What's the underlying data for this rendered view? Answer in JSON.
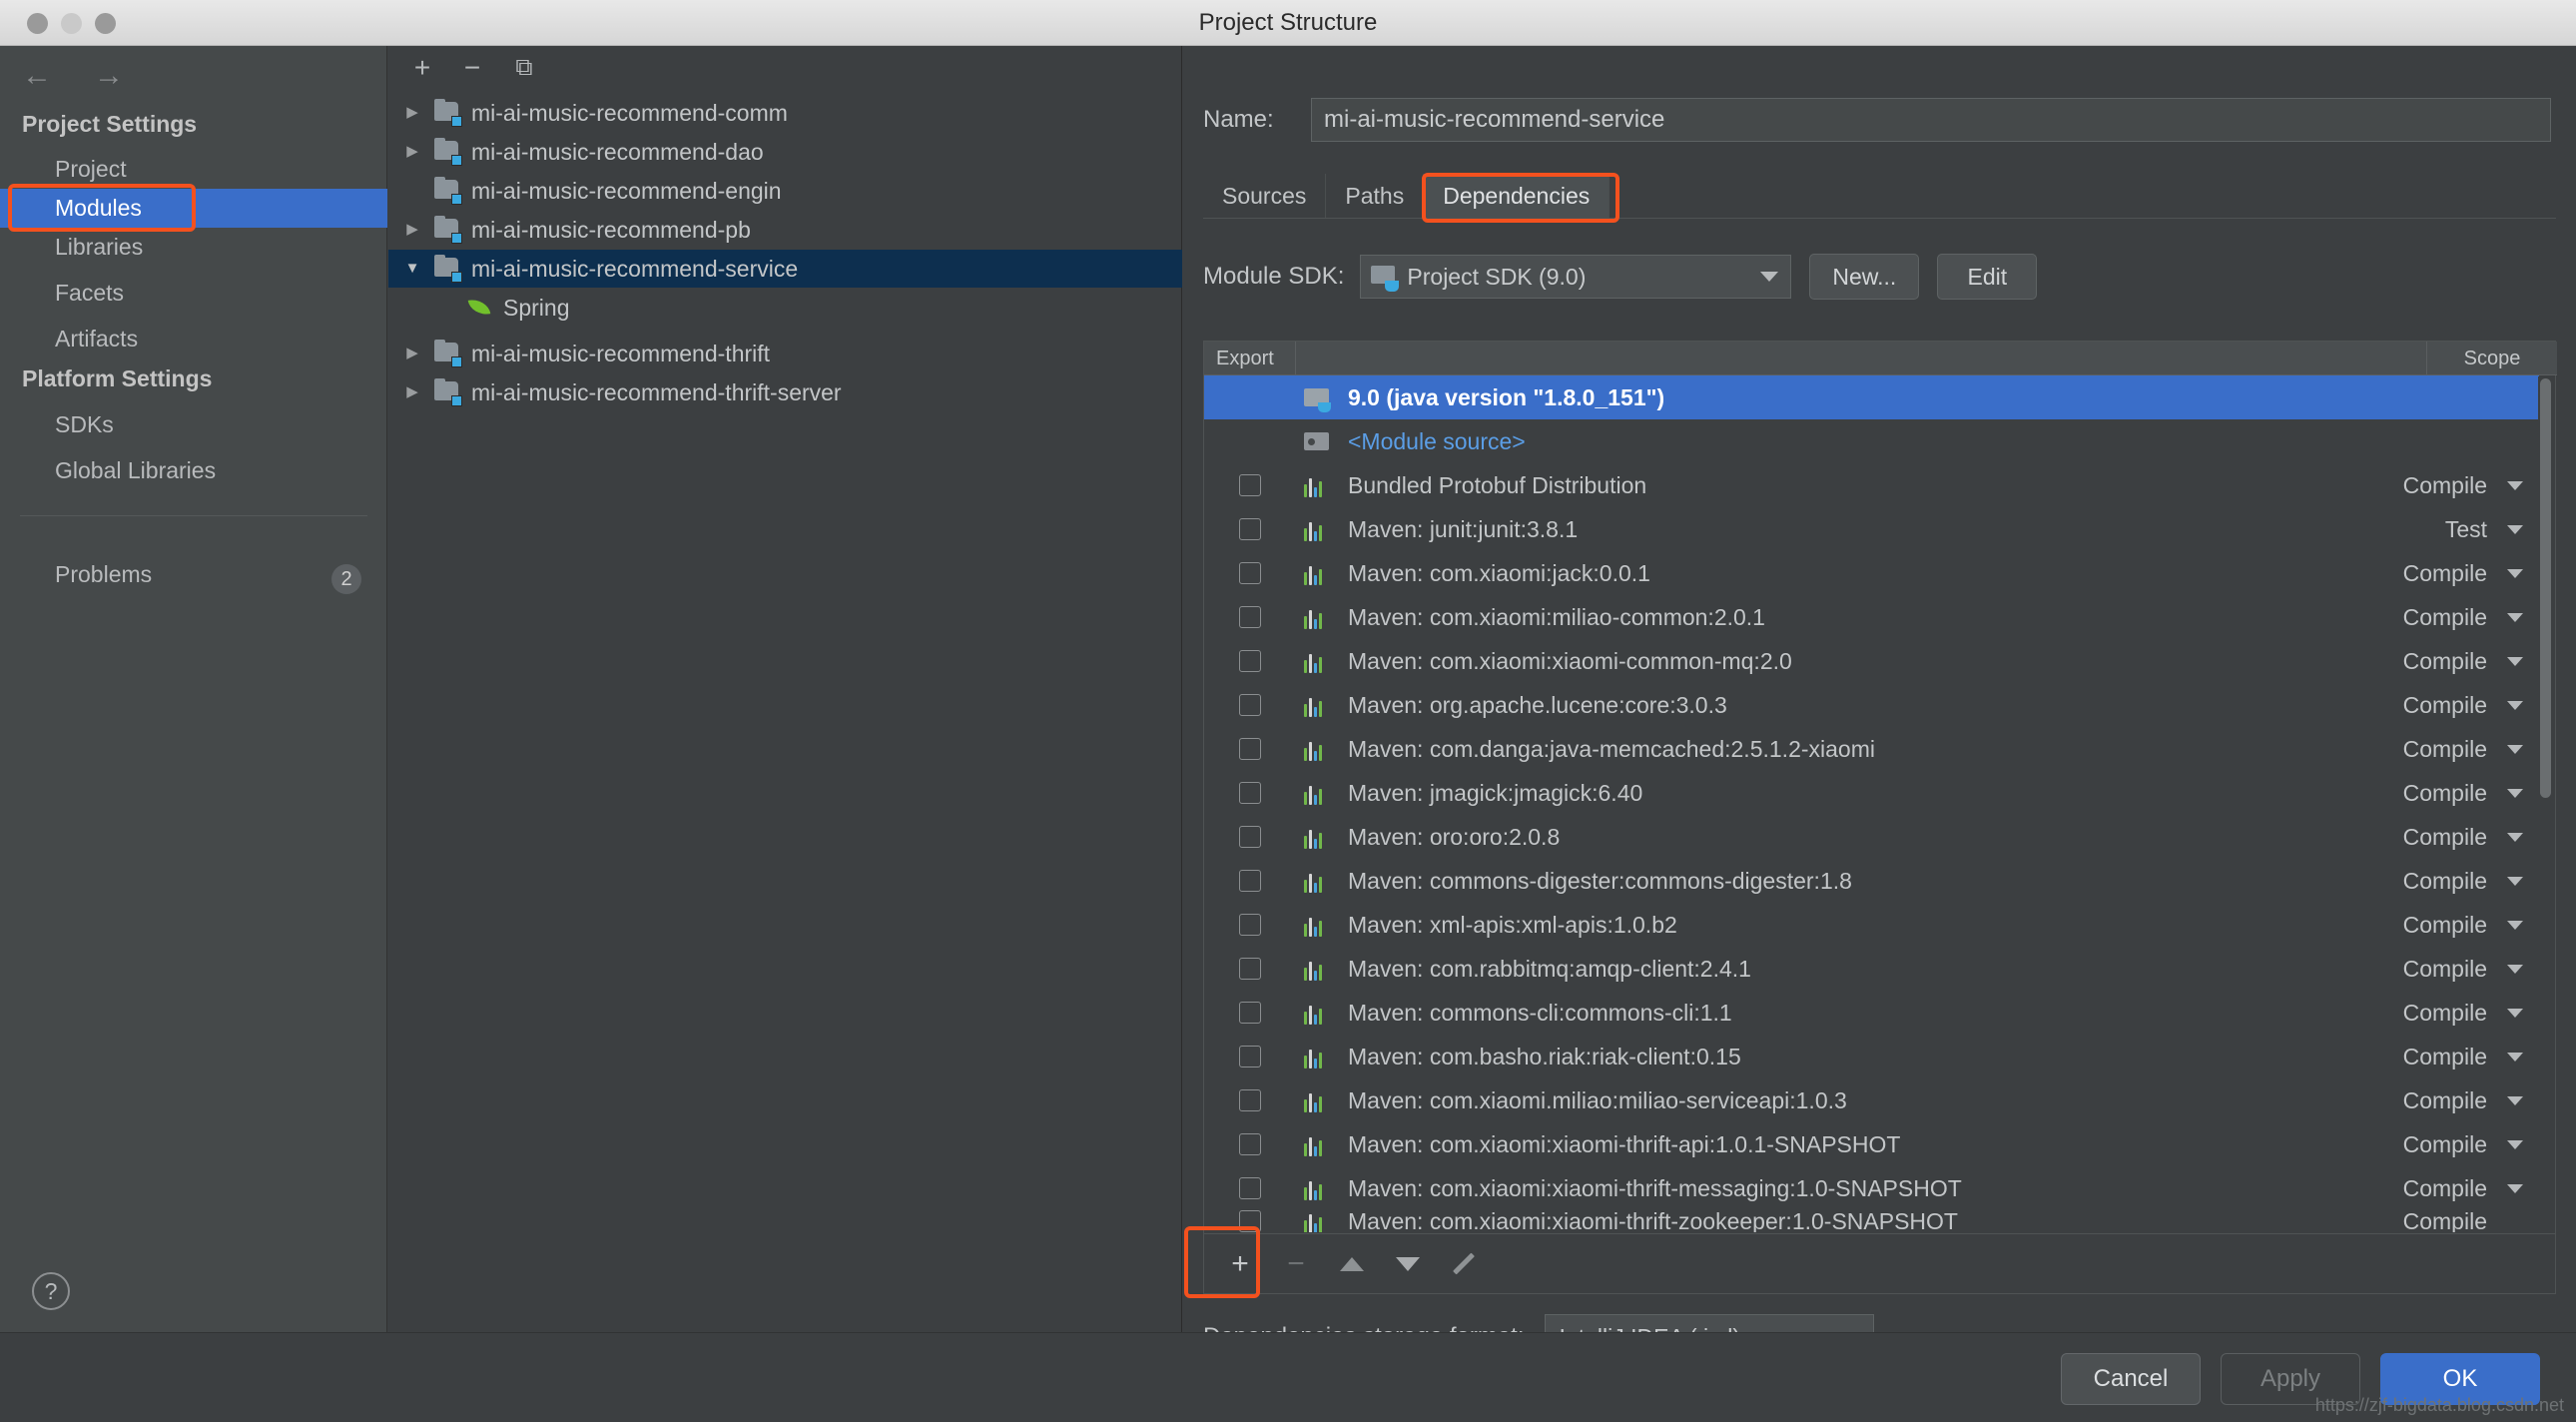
{
  "window": {
    "title": "Project Structure",
    "traffic_lights": [
      "close",
      "minimize",
      "zoom"
    ]
  },
  "sidebar": {
    "nav": {
      "back_icon": "arrow-left-icon",
      "forward_icon": "arrow-right-icon"
    },
    "groups": [
      {
        "header": "Project Settings",
        "items": [
          {
            "label": "Project",
            "selected": false
          },
          {
            "label": "Modules",
            "selected": true
          },
          {
            "label": "Libraries",
            "selected": false
          },
          {
            "label": "Facets",
            "selected": false
          },
          {
            "label": "Artifacts",
            "selected": false
          }
        ]
      },
      {
        "header": "Platform Settings",
        "items": [
          {
            "label": "SDKs",
            "selected": false
          },
          {
            "label": "Global Libraries",
            "selected": false
          }
        ]
      }
    ],
    "problems": {
      "label": "Problems",
      "count": "2"
    },
    "help_label": "?"
  },
  "modules_panel": {
    "toolbar": [
      {
        "name": "add-module-button",
        "glyph": "+"
      },
      {
        "name": "remove-module-button",
        "glyph": "−"
      },
      {
        "name": "copy-module-button",
        "glyph": "⧉"
      }
    ],
    "tree": [
      {
        "label": "mi-ai-music-recommend-comm",
        "twisty": "collapsed",
        "depth": 0,
        "selected": false,
        "icon": "module-folder-icon"
      },
      {
        "label": "mi-ai-music-recommend-dao",
        "twisty": "collapsed",
        "depth": 0,
        "selected": false,
        "icon": "module-folder-icon"
      },
      {
        "label": "mi-ai-music-recommend-engin",
        "twisty": "none",
        "depth": 0,
        "selected": false,
        "icon": "module-folder-icon"
      },
      {
        "label": "mi-ai-music-recommend-pb",
        "twisty": "collapsed",
        "depth": 0,
        "selected": false,
        "icon": "module-folder-icon"
      },
      {
        "label": "mi-ai-music-recommend-service",
        "twisty": "expanded",
        "depth": 0,
        "selected": true,
        "icon": "module-folder-icon"
      },
      {
        "label": "Spring",
        "twisty": "none",
        "depth": 1,
        "selected": false,
        "icon": "spring-leaf-icon"
      },
      {
        "label": "mi-ai-music-recommend-thrift",
        "twisty": "collapsed",
        "depth": 0,
        "selected": false,
        "icon": "module-folder-icon"
      },
      {
        "label": "mi-ai-music-recommend-thrift-server",
        "twisty": "collapsed",
        "depth": 0,
        "selected": false,
        "icon": "module-folder-icon"
      }
    ]
  },
  "detail": {
    "name_label": "Name:",
    "name_value": "mi-ai-music-recommend-service",
    "tabs": [
      {
        "label": "Sources",
        "active": false
      },
      {
        "label": "Paths",
        "active": false
      },
      {
        "label": "Dependencies",
        "active": true
      }
    ],
    "sdk": {
      "label": "Module SDK:",
      "value": "Project SDK  (9.0)",
      "new_button": "New...",
      "edit_button": "Edit"
    },
    "table": {
      "columns": {
        "export": "Export",
        "scope": "Scope"
      },
      "rows": [
        {
          "name": "9.0 (java version \"1.8.0_151\")",
          "icon": "jdk-folder-icon",
          "scope": "",
          "checkbox": false,
          "selected": true,
          "style": "white"
        },
        {
          "name": "<Module source>",
          "icon": "module-source-icon",
          "scope": "",
          "checkbox": false,
          "selected": false,
          "style": "link"
        },
        {
          "name": "Bundled Protobuf Distribution",
          "icon": "library-icon",
          "scope": "Compile",
          "checkbox": true,
          "selected": false,
          "style": "normal"
        },
        {
          "name": "Maven: junit:junit:3.8.1",
          "icon": "library-icon",
          "scope": "Test",
          "checkbox": true,
          "selected": false,
          "style": "normal"
        },
        {
          "name": "Maven: com.xiaomi:jack:0.0.1",
          "icon": "library-icon",
          "scope": "Compile",
          "checkbox": true,
          "selected": false,
          "style": "normal"
        },
        {
          "name": "Maven: com.xiaomi:miliao-common:2.0.1",
          "icon": "library-icon",
          "scope": "Compile",
          "checkbox": true,
          "selected": false,
          "style": "normal"
        },
        {
          "name": "Maven: com.xiaomi:xiaomi-common-mq:2.0",
          "icon": "library-icon",
          "scope": "Compile",
          "checkbox": true,
          "selected": false,
          "style": "normal"
        },
        {
          "name": "Maven: org.apache.lucene:core:3.0.3",
          "icon": "library-icon",
          "scope": "Compile",
          "checkbox": true,
          "selected": false,
          "style": "normal"
        },
        {
          "name": "Maven: com.danga:java-memcached:2.5.1.2-xiaomi",
          "icon": "library-icon",
          "scope": "Compile",
          "checkbox": true,
          "selected": false,
          "style": "normal"
        },
        {
          "name": "Maven: jmagick:jmagick:6.40",
          "icon": "library-icon",
          "scope": "Compile",
          "checkbox": true,
          "selected": false,
          "style": "normal"
        },
        {
          "name": "Maven: oro:oro:2.0.8",
          "icon": "library-icon",
          "scope": "Compile",
          "checkbox": true,
          "selected": false,
          "style": "normal"
        },
        {
          "name": "Maven: commons-digester:commons-digester:1.8",
          "icon": "library-icon",
          "scope": "Compile",
          "checkbox": true,
          "selected": false,
          "style": "normal"
        },
        {
          "name": "Maven: xml-apis:xml-apis:1.0.b2",
          "icon": "library-icon",
          "scope": "Compile",
          "checkbox": true,
          "selected": false,
          "style": "normal"
        },
        {
          "name": "Maven: com.rabbitmq:amqp-client:2.4.1",
          "icon": "library-icon",
          "scope": "Compile",
          "checkbox": true,
          "selected": false,
          "style": "normal"
        },
        {
          "name": "Maven: commons-cli:commons-cli:1.1",
          "icon": "library-icon",
          "scope": "Compile",
          "checkbox": true,
          "selected": false,
          "style": "normal"
        },
        {
          "name": "Maven: com.basho.riak:riak-client:0.15",
          "icon": "library-icon",
          "scope": "Compile",
          "checkbox": true,
          "selected": false,
          "style": "normal"
        },
        {
          "name": "Maven: com.xiaomi.miliao:miliao-serviceapi:1.0.3",
          "icon": "library-icon",
          "scope": "Compile",
          "checkbox": true,
          "selected": false,
          "style": "normal"
        },
        {
          "name": "Maven: com.xiaomi:xiaomi-thrift-api:1.0.1-SNAPSHOT",
          "icon": "library-icon",
          "scope": "Compile",
          "checkbox": true,
          "selected": false,
          "style": "normal"
        },
        {
          "name": "Maven: com.xiaomi:xiaomi-thrift-messaging:1.0-SNAPSHOT",
          "icon": "library-icon",
          "scope": "Compile",
          "checkbox": true,
          "selected": false,
          "style": "normal"
        },
        {
          "name": "Maven: com.xiaomi:xiaomi-thrift-zookeeper:1.0-SNAPSHOT",
          "icon": "library-icon",
          "scope": "Compile",
          "checkbox": true,
          "selected": false,
          "style": "clipped"
        }
      ]
    },
    "table_toolbar": [
      {
        "name": "add-dependency-button",
        "glyph": "+",
        "enabled": true
      },
      {
        "name": "remove-dependency-button",
        "glyph": "−",
        "enabled": false
      },
      {
        "name": "move-up-button",
        "glyph": "▲",
        "enabled": true
      },
      {
        "name": "move-down-button",
        "glyph": "▼",
        "enabled": true
      },
      {
        "name": "edit-dependency-button",
        "glyph": "✎",
        "enabled": true
      }
    ],
    "storage": {
      "label": "Dependencies storage format:",
      "value": "IntelliJ IDEA (.iml)"
    }
  },
  "footer": {
    "cancel": "Cancel",
    "apply": "Apply",
    "ok": "OK",
    "watermark": "https://zjf-bigdata.blog.csdn.net"
  },
  "annotations": {
    "accent_color": "#f4511e",
    "targets": [
      "modules-sidebar-item",
      "dependencies-tab",
      "add-dependency-button"
    ]
  }
}
